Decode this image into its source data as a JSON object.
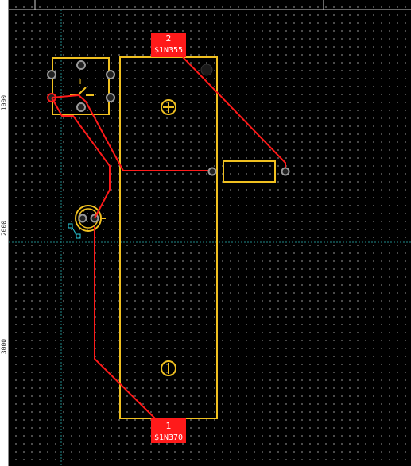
{
  "ruler": {
    "labels": [
      "1000",
      "2000",
      "3000"
    ]
  },
  "colors": {
    "background": "#000000",
    "outline": "#f0c020",
    "track": "#ff1a1a",
    "pad": "#9a9a9a",
    "crosshair": "#1f8a8a",
    "selection": "#2ad0e0",
    "ruler_bg": "#ffffff"
  },
  "pads": {
    "top": {
      "number": "2",
      "net": "$1N355"
    },
    "bottom": {
      "number": "1",
      "net": "$1N370"
    }
  },
  "component_markings": {
    "switch": "T"
  }
}
